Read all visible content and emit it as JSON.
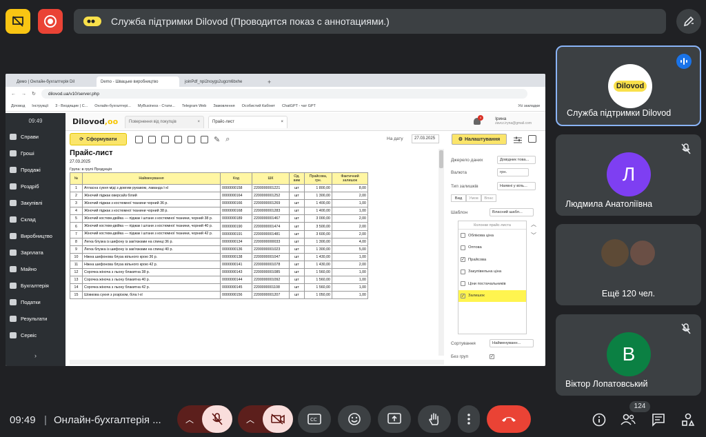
{
  "topbar": {
    "presentation_title": "Служба підтримки Dilovod (Проводится показ с аннотациями.)"
  },
  "browser": {
    "tabs": [
      "Демо | Онлайн-бухгалтерія Dil",
      "Demo - Швацьке виробництво",
      "joinPdf_npi2noygs2ugcm6bxhe"
    ],
    "address": "dilovod.ua/v10/server.php",
    "bookmarks": [
      "Діловод",
      "Інструкції",
      "3 - Входящие | C...",
      "Онлайн-бухгалтері...",
      "MyBusiness - Стати...",
      "Telegram Web",
      "Замовлення",
      "Особистий Кабінет",
      "ChatGPT - чат GPT",
      "Усі закладки"
    ]
  },
  "app": {
    "time": "09:49",
    "sidebar": [
      "Справи",
      "Гроші",
      "Продажі",
      "Роздріб",
      "Закупівлі",
      "Склад",
      "Виробництво",
      "Зарплата",
      "Майно",
      "Бухгалтерія",
      "Податки",
      "Результати",
      "Сервіс"
    ],
    "sidebar_more": "›",
    "logo": "Dilovod",
    "tabs": [
      "Повернення від покупців",
      "Прайс-лист"
    ],
    "user_name": "Ірина",
    "user_email": "zavcz.iryna@gmail.com",
    "notif_count": "4",
    "form_button": "Сформувати",
    "date_label": "На дату",
    "date_value": "27.03.2025",
    "settings_button": "Налаштування"
  },
  "report": {
    "title": "Прайс-лист",
    "date": "27.03.2025",
    "group": "Група:  в групі Продукція",
    "headers": [
      "№",
      "Найменування",
      "Код",
      "ШК",
      "Од. вим",
      "Прайсова, грн.",
      "Фактичний залишок"
    ],
    "rows": [
      [
        "1",
        "Атласна сукня міді з довгим рукавом, лаванда l-xl",
        "0000000158",
        "2200000001221",
        "шт",
        "1 800,00",
        "8,00"
      ],
      [
        "2",
        "Жіночий  піджак оверсайз білий",
        "0000000164",
        "2200000001252",
        "шт",
        "1 300,00",
        "2,00"
      ],
      [
        "3",
        "Жіночий  піджак з костюмної тканини чорний 36 р.",
        "0000000166",
        "2200000001269",
        "шт",
        "1 400,00",
        "1,00"
      ],
      [
        "4",
        "Жіночий  піджак з костюмної тканини чорний 38 р.",
        "0000000168",
        "2200000001283",
        "шт",
        "1 400,00",
        "1,00"
      ],
      [
        "5",
        "Жіночий костюм-двійка — піджак і штани з костюмної тканини, чорний 38 р.",
        "0000000189",
        "2200000001467",
        "шт",
        "3 000,00",
        "2,00"
      ],
      [
        "6",
        "Жіночий костюм-двійка — піджак і штани з костюмної тканини, чорний 40 р.",
        "0000000190",
        "2200000001474",
        "шт",
        "3 500,00",
        "2,00"
      ],
      [
        "7",
        "Жіночий костюм-двійка — піджак і штани з костюмної тканини, чорний 42 р.",
        "0000000191",
        "2200000001481",
        "шт",
        "3 600,00",
        "2,00"
      ],
      [
        "8",
        "Легка блузка із шифону із зав'язками на спинці 36 р.",
        "0000000134",
        "2200000000033",
        "шт",
        "1 300,00",
        "4,00"
      ],
      [
        "9",
        "Легка блузка із шифону із зав'язками на спинці 40 р.",
        "0000000136",
        "2200000001023",
        "шт",
        "1 300,00",
        "5,00"
      ],
      [
        "10",
        "Ніжна шифонова блуза вільного крою 36 р.",
        "0000000138",
        "2200000001047",
        "шт",
        "1 430,00",
        "1,00"
      ],
      [
        "11",
        "Ніжна шифонова блуза вільного крою 42 р.",
        "0000000141",
        "2200000001078",
        "шт",
        "1 430,00",
        "2,00"
      ],
      [
        "12",
        "Сорочка жіноча з льону блакитна 38 р.",
        "0000000143",
        "2200000001085",
        "шт",
        "1 560,00",
        "1,00"
      ],
      [
        "13",
        "Сорочка жіноча з льону блакитна 40 р.",
        "0000000144",
        "2200000001092",
        "шт",
        "1 560,00",
        "1,00"
      ],
      [
        "14",
        "Сорочка жіноча з льону блакитна 42 р.",
        "0000000145",
        "2200000001108",
        "шт",
        "1 560,00",
        "1,00"
      ],
      [
        "15",
        "Шовкова сукня з розрізом, біла l-xl",
        "0000000156",
        "2200000001207",
        "шт",
        "1 050,00",
        "1,00"
      ]
    ]
  },
  "settings": {
    "price_source_label": "Джерело даних",
    "price_source_value": "Довідник това...",
    "currency_label": "Валюта",
    "currency_value": "грн.",
    "stock_type_label": "Тип залишків",
    "stock_type_value": "Наявні у віль...",
    "view_tabs": [
      "Вид",
      "Умов",
      "Впас"
    ],
    "template_label": "Шаблон",
    "template_value": "Власний шабл...",
    "columns_header": "Колонки прайс-листа",
    "columns": [
      {
        "label": "Облікова ціна",
        "checked": false,
        "highlight": false
      },
      {
        "label": "Оптова",
        "checked": false,
        "highlight": false
      },
      {
        "label": "Прайсова",
        "checked": true,
        "highlight": false
      },
      {
        "label": "Закупівельна ціна",
        "checked": false,
        "highlight": false
      },
      {
        "label": "Ціни постачальників",
        "checked": false,
        "highlight": false
      },
      {
        "label": "Залишок",
        "checked": true,
        "highlight": true
      }
    ],
    "sort_label": "Сортування",
    "sort_value": "Найменуванн...",
    "no_groups_label": "Без груп"
  },
  "participants": [
    {
      "name": "Служба підтримки Dilovod",
      "avatar_text": "Dilovod",
      "speaking": true
    },
    {
      "name": "Людмила Анатоліївна",
      "avatar_letter": "Л",
      "avatar_color": "#7e3ff2",
      "muted": true
    },
    {
      "name": "Ещё 120 чел."
    },
    {
      "name": "Віктор Лопатовський",
      "avatar_letter": "В",
      "avatar_color": "#0b8043",
      "muted": true
    }
  ],
  "bottombar": {
    "time": "09:49",
    "meeting_name": "Онлайн-бухгалтерія ...",
    "participant_count": "124"
  },
  "colors": {
    "accent_yellow": "#f9c513",
    "record_red": "#ea4335",
    "end_call": "#ea4335",
    "active_border": "#8ab4f8"
  }
}
